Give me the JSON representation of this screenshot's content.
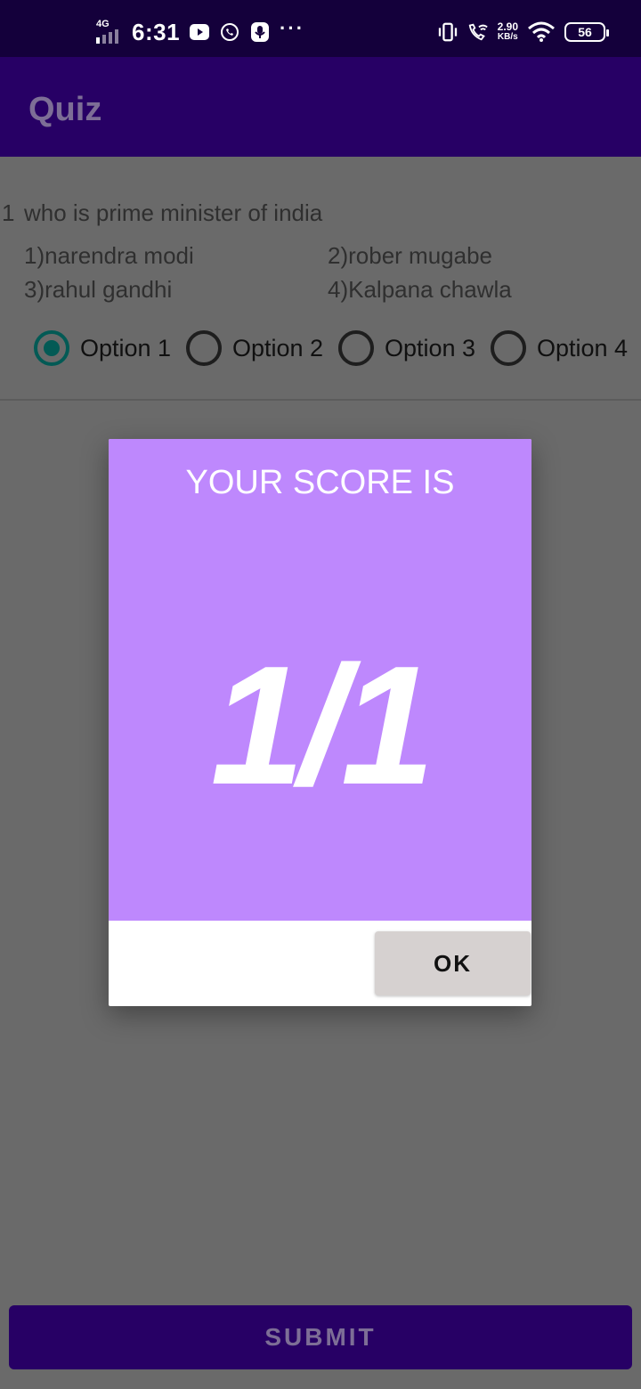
{
  "status_bar": {
    "network": "4G",
    "time": "6:31",
    "speed_value": "2.90",
    "speed_unit": "KB/s",
    "battery": "56",
    "left_icons": [
      "youtube-icon",
      "whatsapp-icon",
      "microphone-icon",
      "more-dots-icon"
    ],
    "right_icons": [
      "vibrate-icon",
      "wifi-calling-icon",
      "wifi-icon",
      "battery-icon"
    ]
  },
  "app_bar": {
    "title": "Quiz"
  },
  "question": {
    "number": "1",
    "text": "who is prime minister of india",
    "choices": [
      "1)narendra modi",
      "2)rober mugabe",
      "3)rahul gandhi",
      "4)Kalpana chawla"
    ],
    "options": [
      "Option 1",
      "Option 2",
      "Option 3",
      "Option 4"
    ],
    "selected_option": "Option 1"
  },
  "dialog": {
    "title": "YOUR SCORE IS",
    "score": "1/1",
    "ok_label": "OK"
  },
  "submit_label": "SUBMIT",
  "colors": {
    "status_bar": "#14003b",
    "app_bar": "#270065",
    "dialog_accent": "#be88fd",
    "radio_checked": "#035a55",
    "scrim": "#6a6a6a"
  }
}
